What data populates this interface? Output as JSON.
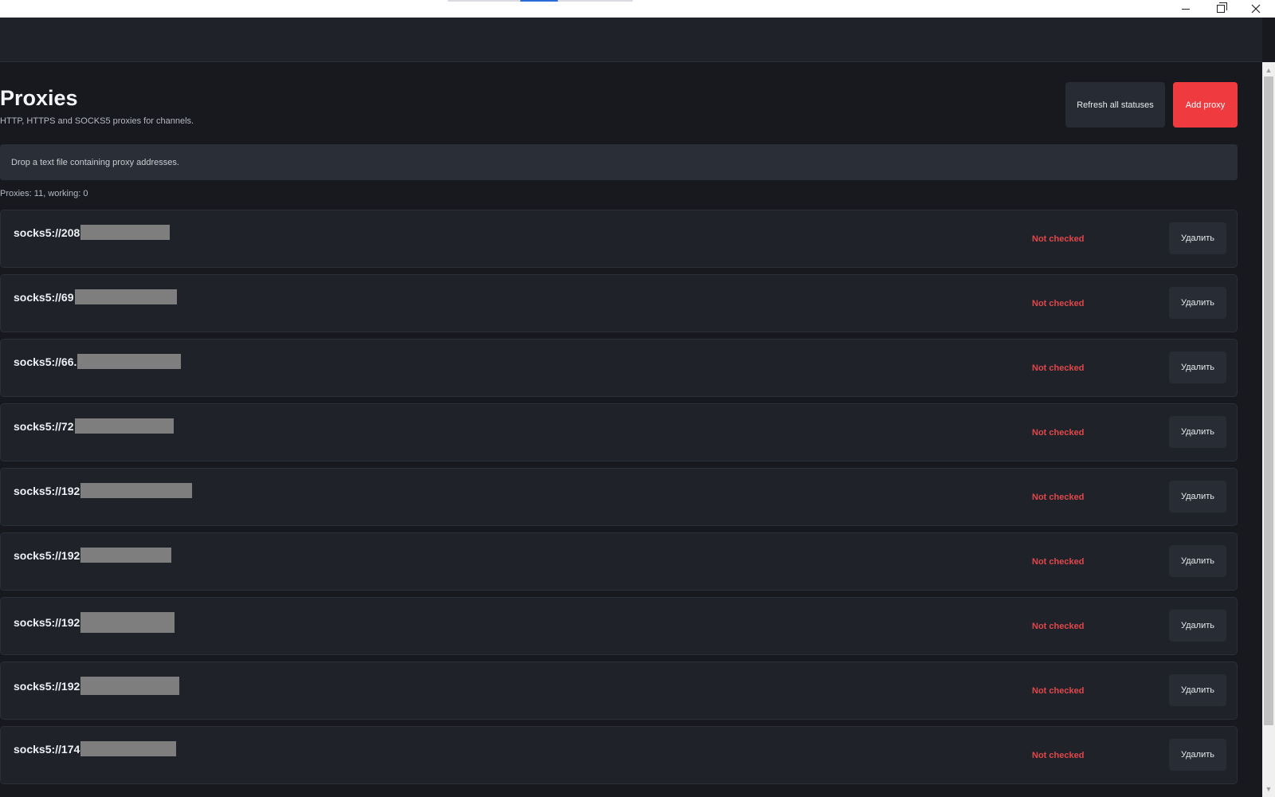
{
  "window": {
    "minimize_label": "—",
    "maximize_label": "",
    "close_label": "×"
  },
  "page": {
    "title": "Proxies",
    "subtitle": "HTTP, HTTPS and SOCKS5 proxies for channels."
  },
  "actions": {
    "refresh_label": "Refresh all statuses",
    "add_label": "Add proxy"
  },
  "dropzone": {
    "text": "Drop a text file containing proxy addresses."
  },
  "summary": {
    "text": "Proxies: 11, working: 0"
  },
  "colors": {
    "accent_red": "#ef3b3f",
    "status_red": "#e0474b",
    "background": "#17191e",
    "card": "#1f2229"
  },
  "proxies": [
    {
      "address": "socks5://208",
      "status": "Not checked",
      "delete_label": "Удалить"
    },
    {
      "address": "socks5://69",
      "status": "Not checked",
      "delete_label": "Удалить"
    },
    {
      "address": "socks5://66.",
      "status": "Not checked",
      "delete_label": "Удалить"
    },
    {
      "address": "socks5://72",
      "status": "Not checked",
      "delete_label": "Удалить"
    },
    {
      "address": "socks5://192",
      "status": "Not checked",
      "delete_label": "Удалить"
    },
    {
      "address": "socks5://192",
      "status": "Not checked",
      "delete_label": "Удалить"
    },
    {
      "address": "socks5://192",
      "status": "Not checked",
      "delete_label": "Удалить"
    },
    {
      "address": "socks5://192",
      "status": "Not checked",
      "delete_label": "Удалить"
    },
    {
      "address": "socks5://174",
      "status": "Not checked",
      "delete_label": "Удалить"
    }
  ]
}
